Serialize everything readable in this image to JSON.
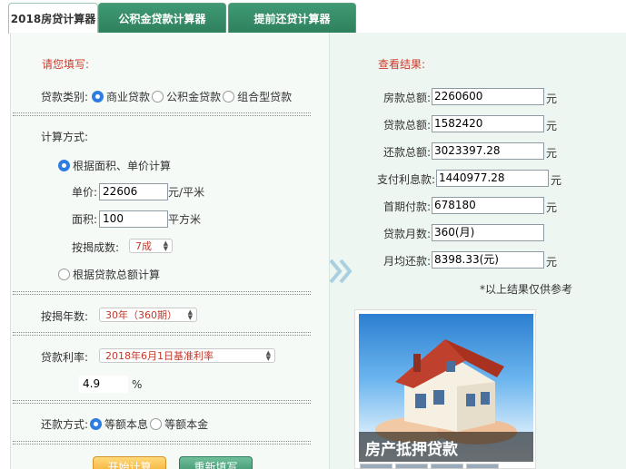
{
  "tabs": [
    {
      "label": "2018房贷计算器"
    },
    {
      "label": "公积金贷款计算器"
    },
    {
      "label": "提前还贷计算器"
    }
  ],
  "form": {
    "title": "请您填写:",
    "loan_type_label": "贷款类别:",
    "loan_types": [
      "商业贷款",
      "公积金贷款",
      "组合型贷款"
    ],
    "calc_method_label": "计算方式:",
    "method_area": "根据面积、单价计算",
    "unit_price_label": "单价:",
    "unit_price_value": "22606",
    "unit_price_unit": "元/平米",
    "area_label": "面积:",
    "area_value": "100",
    "area_unit": "平方米",
    "mortgage_ratio_label": "按揭成数:",
    "mortgage_ratio_value": "7成",
    "method_total": "根据贷款总额计算",
    "years_label": "按揭年数:",
    "years_value": "30年（360期）",
    "rate_label": "贷款利率:",
    "rate_value": "2018年6月1日基准利率",
    "rate_number": "4.9",
    "rate_unit": "%",
    "repay_label": "还款方式:",
    "repay_options": [
      "等额本息",
      "等额本金"
    ],
    "calc_button": "开始计算",
    "reset_button": "重新填写"
  },
  "results": {
    "title": "查看结果:",
    "rows": [
      {
        "label": "房款总额:",
        "value": "2260600",
        "unit": "元"
      },
      {
        "label": "贷款总额:",
        "value": "1582420",
        "unit": "元"
      },
      {
        "label": "还款总额:",
        "value": "3023397.28",
        "unit": "元"
      },
      {
        "label": "支付利息款:",
        "value": "1440977.28",
        "unit": "元"
      },
      {
        "label": "首期付款:",
        "value": "678180",
        "unit": "元"
      },
      {
        "label": "贷款月数:",
        "value": "360(月)",
        "unit": ""
      },
      {
        "label": "月均还款:",
        "value": "8398.33(元)",
        "unit": "元"
      }
    ],
    "note": "*以上结果仅供参考"
  },
  "ad": {
    "caption": "房产抵押贷款"
  },
  "colors": {
    "tab_green": "#2f805d",
    "title_red": "#d03a2b",
    "radio_blue": "#2f7de1",
    "calc_orange": "#f2a92b",
    "reset_green": "#3b8f6c"
  }
}
